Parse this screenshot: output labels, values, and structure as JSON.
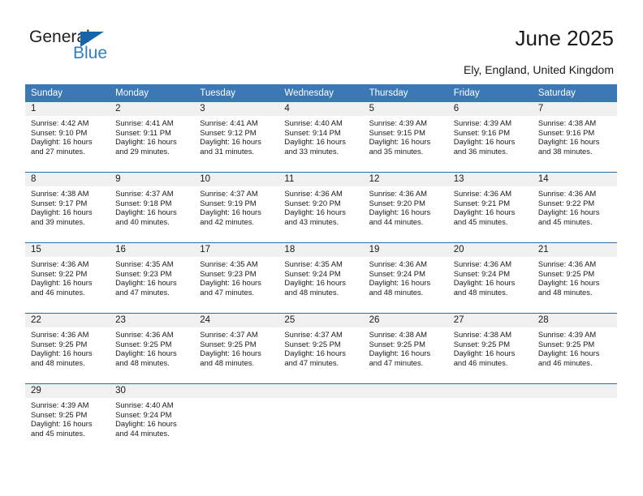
{
  "logo": {
    "word_one": "General",
    "word_two": "Blue",
    "triangle_icon": "blue-triangle-icon",
    "brand_dark": "#202020",
    "brand_blue": "#2f7fc8",
    "triangle_color": "#1565a8"
  },
  "header": {
    "title": "June 2025",
    "subtitle": "Ely, England, United Kingdom"
  },
  "colors": {
    "header_blue": "#3b78b5",
    "row_separator": "#2e6da4",
    "daynum_band": "#f0f0f0",
    "text": "#1a1a1a"
  },
  "calendar": {
    "weekday_headers": [
      "Sunday",
      "Monday",
      "Tuesday",
      "Wednesday",
      "Thursday",
      "Friday",
      "Saturday"
    ],
    "weeks": [
      [
        {
          "day": "1",
          "sunrise": "Sunrise: 4:42 AM",
          "sunset": "Sunset: 9:10 PM",
          "daylight_1": "Daylight: 16 hours",
          "daylight_2": "and 27 minutes."
        },
        {
          "day": "2",
          "sunrise": "Sunrise: 4:41 AM",
          "sunset": "Sunset: 9:11 PM",
          "daylight_1": "Daylight: 16 hours",
          "daylight_2": "and 29 minutes."
        },
        {
          "day": "3",
          "sunrise": "Sunrise: 4:41 AM",
          "sunset": "Sunset: 9:12 PM",
          "daylight_1": "Daylight: 16 hours",
          "daylight_2": "and 31 minutes."
        },
        {
          "day": "4",
          "sunrise": "Sunrise: 4:40 AM",
          "sunset": "Sunset: 9:14 PM",
          "daylight_1": "Daylight: 16 hours",
          "daylight_2": "and 33 minutes."
        },
        {
          "day": "5",
          "sunrise": "Sunrise: 4:39 AM",
          "sunset": "Sunset: 9:15 PM",
          "daylight_1": "Daylight: 16 hours",
          "daylight_2": "and 35 minutes."
        },
        {
          "day": "6",
          "sunrise": "Sunrise: 4:39 AM",
          "sunset": "Sunset: 9:16 PM",
          "daylight_1": "Daylight: 16 hours",
          "daylight_2": "and 36 minutes."
        },
        {
          "day": "7",
          "sunrise": "Sunrise: 4:38 AM",
          "sunset": "Sunset: 9:16 PM",
          "daylight_1": "Daylight: 16 hours",
          "daylight_2": "and 38 minutes."
        }
      ],
      [
        {
          "day": "8",
          "sunrise": "Sunrise: 4:38 AM",
          "sunset": "Sunset: 9:17 PM",
          "daylight_1": "Daylight: 16 hours",
          "daylight_2": "and 39 minutes."
        },
        {
          "day": "9",
          "sunrise": "Sunrise: 4:37 AM",
          "sunset": "Sunset: 9:18 PM",
          "daylight_1": "Daylight: 16 hours",
          "daylight_2": "and 40 minutes."
        },
        {
          "day": "10",
          "sunrise": "Sunrise: 4:37 AM",
          "sunset": "Sunset: 9:19 PM",
          "daylight_1": "Daylight: 16 hours",
          "daylight_2": "and 42 minutes."
        },
        {
          "day": "11",
          "sunrise": "Sunrise: 4:36 AM",
          "sunset": "Sunset: 9:20 PM",
          "daylight_1": "Daylight: 16 hours",
          "daylight_2": "and 43 minutes."
        },
        {
          "day": "12",
          "sunrise": "Sunrise: 4:36 AM",
          "sunset": "Sunset: 9:20 PM",
          "daylight_1": "Daylight: 16 hours",
          "daylight_2": "and 44 minutes."
        },
        {
          "day": "13",
          "sunrise": "Sunrise: 4:36 AM",
          "sunset": "Sunset: 9:21 PM",
          "daylight_1": "Daylight: 16 hours",
          "daylight_2": "and 45 minutes."
        },
        {
          "day": "14",
          "sunrise": "Sunrise: 4:36 AM",
          "sunset": "Sunset: 9:22 PM",
          "daylight_1": "Daylight: 16 hours",
          "daylight_2": "and 45 minutes."
        }
      ],
      [
        {
          "day": "15",
          "sunrise": "Sunrise: 4:36 AM",
          "sunset": "Sunset: 9:22 PM",
          "daylight_1": "Daylight: 16 hours",
          "daylight_2": "and 46 minutes."
        },
        {
          "day": "16",
          "sunrise": "Sunrise: 4:35 AM",
          "sunset": "Sunset: 9:23 PM",
          "daylight_1": "Daylight: 16 hours",
          "daylight_2": "and 47 minutes."
        },
        {
          "day": "17",
          "sunrise": "Sunrise: 4:35 AM",
          "sunset": "Sunset: 9:23 PM",
          "daylight_1": "Daylight: 16 hours",
          "daylight_2": "and 47 minutes."
        },
        {
          "day": "18",
          "sunrise": "Sunrise: 4:35 AM",
          "sunset": "Sunset: 9:24 PM",
          "daylight_1": "Daylight: 16 hours",
          "daylight_2": "and 48 minutes."
        },
        {
          "day": "19",
          "sunrise": "Sunrise: 4:36 AM",
          "sunset": "Sunset: 9:24 PM",
          "daylight_1": "Daylight: 16 hours",
          "daylight_2": "and 48 minutes."
        },
        {
          "day": "20",
          "sunrise": "Sunrise: 4:36 AM",
          "sunset": "Sunset: 9:24 PM",
          "daylight_1": "Daylight: 16 hours",
          "daylight_2": "and 48 minutes."
        },
        {
          "day": "21",
          "sunrise": "Sunrise: 4:36 AM",
          "sunset": "Sunset: 9:25 PM",
          "daylight_1": "Daylight: 16 hours",
          "daylight_2": "and 48 minutes."
        }
      ],
      [
        {
          "day": "22",
          "sunrise": "Sunrise: 4:36 AM",
          "sunset": "Sunset: 9:25 PM",
          "daylight_1": "Daylight: 16 hours",
          "daylight_2": "and 48 minutes."
        },
        {
          "day": "23",
          "sunrise": "Sunrise: 4:36 AM",
          "sunset": "Sunset: 9:25 PM",
          "daylight_1": "Daylight: 16 hours",
          "daylight_2": "and 48 minutes."
        },
        {
          "day": "24",
          "sunrise": "Sunrise: 4:37 AM",
          "sunset": "Sunset: 9:25 PM",
          "daylight_1": "Daylight: 16 hours",
          "daylight_2": "and 48 minutes."
        },
        {
          "day": "25",
          "sunrise": "Sunrise: 4:37 AM",
          "sunset": "Sunset: 9:25 PM",
          "daylight_1": "Daylight: 16 hours",
          "daylight_2": "and 47 minutes."
        },
        {
          "day": "26",
          "sunrise": "Sunrise: 4:38 AM",
          "sunset": "Sunset: 9:25 PM",
          "daylight_1": "Daylight: 16 hours",
          "daylight_2": "and 47 minutes."
        },
        {
          "day": "27",
          "sunrise": "Sunrise: 4:38 AM",
          "sunset": "Sunset: 9:25 PM",
          "daylight_1": "Daylight: 16 hours",
          "daylight_2": "and 46 minutes."
        },
        {
          "day": "28",
          "sunrise": "Sunrise: 4:39 AM",
          "sunset": "Sunset: 9:25 PM",
          "daylight_1": "Daylight: 16 hours",
          "daylight_2": "and 46 minutes."
        }
      ],
      [
        {
          "day": "29",
          "sunrise": "Sunrise: 4:39 AM",
          "sunset": "Sunset: 9:25 PM",
          "daylight_1": "Daylight: 16 hours",
          "daylight_2": "and 45 minutes."
        },
        {
          "day": "30",
          "sunrise": "Sunrise: 4:40 AM",
          "sunset": "Sunset: 9:24 PM",
          "daylight_1": "Daylight: 16 hours",
          "daylight_2": "and 44 minutes."
        },
        {
          "day": "",
          "sunrise": "",
          "sunset": "",
          "daylight_1": "",
          "daylight_2": ""
        },
        {
          "day": "",
          "sunrise": "",
          "sunset": "",
          "daylight_1": "",
          "daylight_2": ""
        },
        {
          "day": "",
          "sunrise": "",
          "sunset": "",
          "daylight_1": "",
          "daylight_2": ""
        },
        {
          "day": "",
          "sunrise": "",
          "sunset": "",
          "daylight_1": "",
          "daylight_2": ""
        },
        {
          "day": "",
          "sunrise": "",
          "sunset": "",
          "daylight_1": "",
          "daylight_2": ""
        }
      ]
    ]
  }
}
